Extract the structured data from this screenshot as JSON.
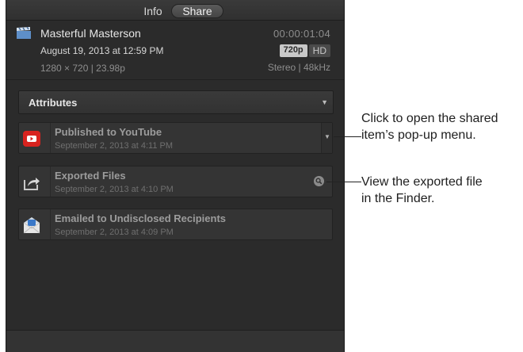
{
  "tabs": {
    "info": "Info",
    "share": "Share"
  },
  "clip": {
    "icon": "clapperboard-icon",
    "title": "Masterful Masterson",
    "date": "August 19, 2013 at 12:59 PM",
    "resolution": "1280 × 720  |  23.98p",
    "timecode": "00:00:01:04",
    "format_badge": "720p",
    "hd_badge": "HD",
    "audio": "Stereo  |  48kHz"
  },
  "attributes": {
    "label": "Attributes",
    "icon": "chevron-down-icon"
  },
  "items": [
    {
      "title": "Published to YouTube",
      "subtitle": "September 2, 2013 at 4:11 PM",
      "icon": "youtube-icon"
    },
    {
      "title": "Exported Files",
      "subtitle": "September 2, 2013 at 4:10 PM",
      "icon": "export-icon"
    },
    {
      "title": "Emailed to Undisclosed Recipients",
      "subtitle": "September 2, 2013 at 4:09 PM",
      "icon": "mail-icon"
    }
  ],
  "callouts": {
    "menu_line1": "Click to open the shared",
    "menu_line2": "item’s pop-up menu.",
    "finder_line1": "View the exported file",
    "finder_line2": "in the Finder."
  },
  "colors": {
    "panel_bg": "#2b2b2b",
    "youtube_red": "#d8231f"
  }
}
